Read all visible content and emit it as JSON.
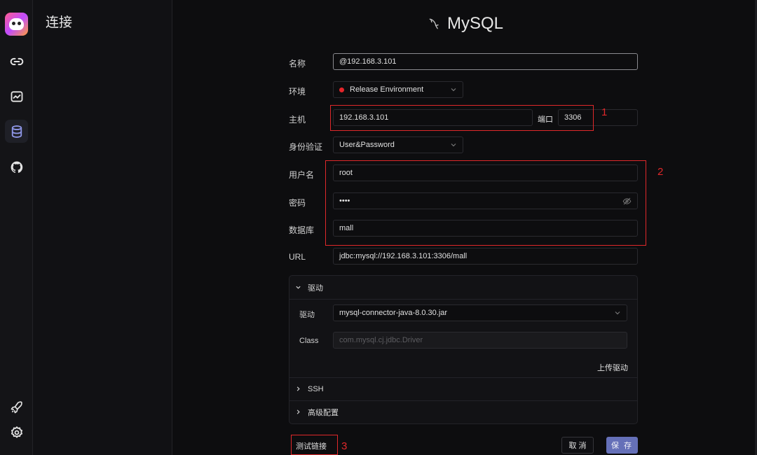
{
  "rail": {
    "items": [
      {
        "icon": "link-icon"
      },
      {
        "icon": "chart-icon"
      },
      {
        "icon": "database-icon",
        "active": true
      },
      {
        "icon": "github-icon"
      }
    ],
    "bottom": [
      {
        "icon": "rocket-icon"
      },
      {
        "icon": "gear-icon"
      }
    ]
  },
  "sidebar": {
    "title": "连接"
  },
  "form": {
    "db_title": "MySQL",
    "name": {
      "label": "名称",
      "value": "@192.168.3.101"
    },
    "env": {
      "label": "环境",
      "value": "Release Environment",
      "dot_color": "#e5252a"
    },
    "host": {
      "label": "主机",
      "value": "192.168.3.101",
      "port_label": "端口",
      "port_value": "3306"
    },
    "auth": {
      "label": "身份验证",
      "value": "User&Password"
    },
    "username": {
      "label": "用户名",
      "value": "root"
    },
    "password": {
      "label": "密码",
      "value": "••••"
    },
    "database": {
      "label": "数据库",
      "value": "mall"
    },
    "url": {
      "label": "URL",
      "value": "jdbc:mysql://192.168.3.101:3306/mall"
    }
  },
  "driver_panel": {
    "title": "驱动",
    "driver_label": "驱动",
    "driver_value": "mysql-connector-java-8.0.30.jar",
    "class_label": "Class",
    "class_placeholder": "com.mysql.cj.jdbc.Driver",
    "upload": "上传驱动",
    "ssh": "SSH",
    "advanced": "高级配置"
  },
  "actions": {
    "test": "测试链接",
    "cancel": "取 消",
    "save": "保 存"
  },
  "annotations": [
    "1",
    "2",
    "3"
  ],
  "colors": {
    "accent": "#6570b8",
    "annotation": "#e0282a"
  }
}
